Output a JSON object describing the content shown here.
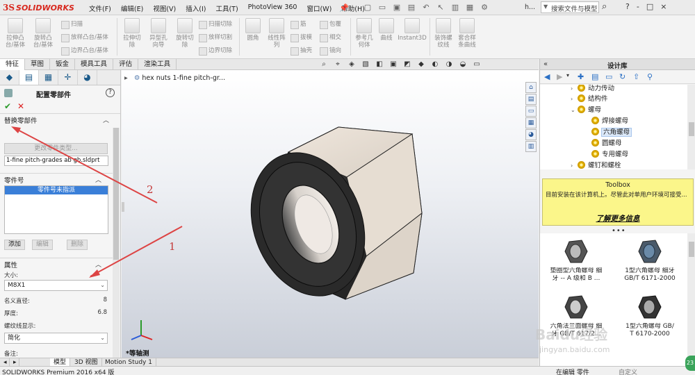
{
  "app": {
    "logo_ds": "3S",
    "logo_text": "SOLIDWORKS",
    "menus": [
      "文件(F)",
      "编辑(E)",
      "视图(V)",
      "插入(I)",
      "工具(T)",
      "PhotoView 360",
      "窗口(W)",
      "帮助(H)"
    ],
    "quick_access_suffix": "h...",
    "search_placeholder": "搜索文件与模型",
    "title_controls": [
      "?",
      "-",
      "□",
      "×"
    ]
  },
  "ribbon": {
    "big_buttons": [
      {
        "label": "拉伸凸\n台/基体"
      },
      {
        "label": "旋转凸\n台/基体"
      },
      {
        "label": "拉伸切\n除"
      },
      {
        "label": "异型孔\n向导"
      },
      {
        "label": "旋转切\n除"
      },
      {
        "label": "圆角"
      },
      {
        "label": "线性阵\n列"
      },
      {
        "label": "参考几\n何体"
      },
      {
        "label": "曲线"
      },
      {
        "label": "Instant3D"
      },
      {
        "label": "装饰螺\n纹线"
      },
      {
        "label": "套合样\n条曲线"
      }
    ],
    "small_buttons": [
      "扫描",
      "放样凸台/基体",
      "边界凸台/基体",
      "扫描切除",
      "放样切割",
      "边界切除",
      "筋",
      "拔模",
      "抽壳",
      "包覆",
      "相交",
      "镜向"
    ]
  },
  "command_tabs": [
    "特征",
    "草图",
    "钣金",
    "模具工具",
    "评估",
    "渲染工具"
  ],
  "property_manager": {
    "title": "配置零部件",
    "help": "?",
    "ok": "✔",
    "cancel": "✕",
    "group_replace": {
      "title": "替换零部件",
      "change_type_button": "更改零件类型...",
      "file_value": "1-fine pitch-grades ab gb.sldprt"
    },
    "group_partno": {
      "title": "零件号",
      "list_item": "零件号未指派",
      "buttons": [
        "添加",
        "编辑",
        "删除"
      ]
    },
    "group_props": {
      "title": "属性",
      "size_label": "大小:",
      "size_value": "M8X1",
      "nominal_label": "名义直径:",
      "nominal_value": "8",
      "thickness_label": "厚度:",
      "thickness_value": "6.8",
      "thread_label": "螺纹线显示:",
      "thread_value": "简化",
      "notes_label": "备注:"
    }
  },
  "viewport": {
    "flyout_title": "hex nuts 1-fine pitch-gr...",
    "view_name": "*等轴测"
  },
  "bottom_tabs": [
    "模型",
    "3D 视图",
    "Motion Study 1"
  ],
  "status": {
    "left": "SOLIDWORKS Premium 2016 x64 版",
    "edit": "在编辑 零件",
    "custom": "自定义"
  },
  "design_library": {
    "title": "设计库",
    "tree": [
      {
        "label": "动力传动",
        "level": 1,
        "expander": "›"
      },
      {
        "label": "结构件",
        "level": 1,
        "expander": "›"
      },
      {
        "label": "螺母",
        "level": 1,
        "expander": "⌄"
      },
      {
        "label": "焊接螺母",
        "level": 2,
        "expander": ""
      },
      {
        "label": "六角螺母",
        "level": 2,
        "expander": "",
        "selected": true
      },
      {
        "label": "圆螺母",
        "level": 2,
        "expander": ""
      },
      {
        "label": "专用螺母",
        "level": 2,
        "expander": ""
      },
      {
        "label": "螺钉和螺栓",
        "level": 1,
        "expander": "›"
      }
    ],
    "toolbox": {
      "title": "Toolbox",
      "message": "目前安装在该计算机上。尽管此对单用户环境可接受...",
      "link": "了解更多信息"
    },
    "gallery": [
      {
        "line1": "垫圈型六角螺母 细",
        "line2": "牙 -- A 级和 B ..."
      },
      {
        "line1": "1型六角螺母 细牙",
        "line2": "GB/T 6171-2000"
      },
      {
        "line1": "六角法兰面螺母 细",
        "line2": "牙 GB/T 617/2..."
      },
      {
        "line1": "1型六角螺母 GB/",
        "line2": "T 6170-2000"
      }
    ]
  },
  "annotations": {
    "arrow_1": "1",
    "arrow_2": "2"
  },
  "watermark": "Baidu经验",
  "watermark_sub": "jingyan.baidu.com",
  "clock_badge": "23"
}
